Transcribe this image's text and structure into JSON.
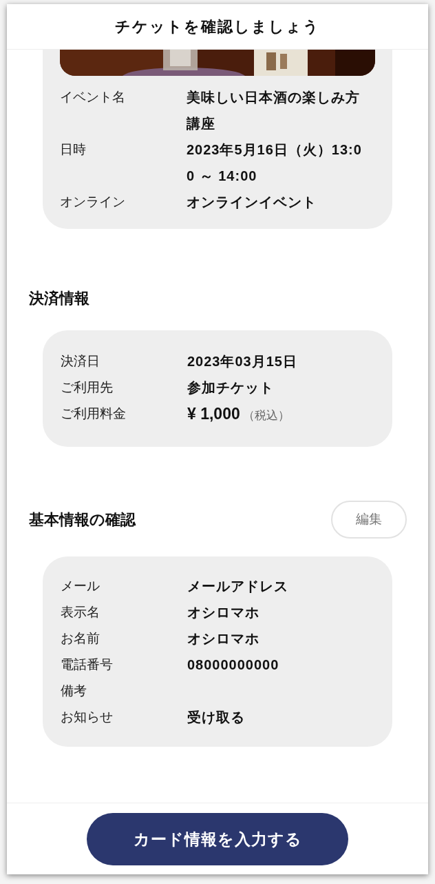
{
  "header": {
    "title": "チケットを確認しましょう"
  },
  "event": {
    "rows": [
      {
        "label": "イベント名",
        "value": "美味しい日本酒の楽しみ方講座"
      },
      {
        "label": "日時",
        "value": "2023年5月16日（火）13:00 ～ 14:00"
      },
      {
        "label": "オンライン",
        "value": "オンラインイベント"
      }
    ]
  },
  "payment": {
    "title": "決済情報",
    "rows": [
      {
        "label": "決済日",
        "value": "2023年03月15日"
      },
      {
        "label": "ご利用先",
        "value": "参加チケット"
      },
      {
        "label": "ご利用料金",
        "value": "¥ 1,000",
        "note": "（税込）"
      }
    ]
  },
  "basic": {
    "title": "基本情報の確認",
    "edit_button": "編集",
    "rows": [
      {
        "label": "メール",
        "value": "メールアドレス"
      },
      {
        "label": "表示名",
        "value": "オシロマホ"
      },
      {
        "label": "お名前",
        "value": "オシロマホ"
      },
      {
        "label": "電話番号",
        "value": "08000000000"
      },
      {
        "label": "備考"
      },
      {
        "label": "お知らせ",
        "value": "受け取る"
      }
    ]
  },
  "footer": {
    "button": "カード情報を入力する"
  }
}
